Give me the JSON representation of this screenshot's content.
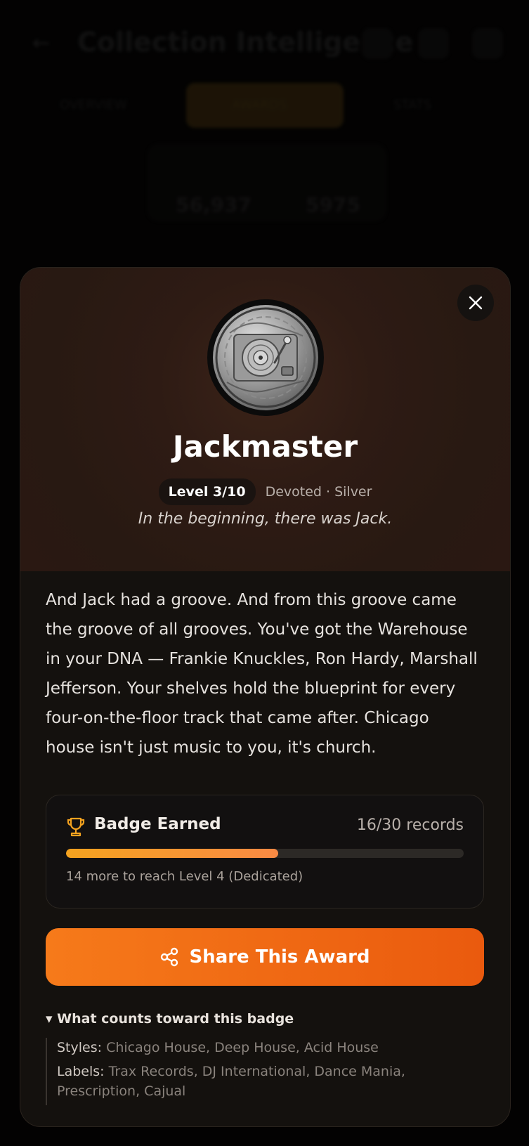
{
  "app": {
    "title": "Collection Intelligence"
  },
  "background": {
    "tabs": [
      "OVERVIEW",
      "AWARDS",
      "STATS"
    ],
    "stats": [
      "56,937",
      "5975"
    ]
  },
  "modal": {
    "badge_name": "Jackmaster",
    "level_label": "Level 3/10",
    "tier_label": "Devoted · Silver",
    "tagline": "In the beginning, there was Jack.",
    "description": "And Jack had a groove. And from this groove came the groove of all grooves. You've got the Warehouse in your DNA — Frankie Knuckles, Ron Hardy, Marshall Jefferson. Your shelves hold the blueprint for every four-on-the-floor track that came after. Chicago house isn't just music to you, it's church.",
    "progress": {
      "title": "Badge Earned",
      "count_label": "16/30 records",
      "current": 16,
      "target": 30,
      "fraction": 0.533,
      "next_label": "14 more to reach Level 4 (Dedicated)"
    },
    "share_label": "Share This Award",
    "criteria": {
      "toggle_label": "▾ What counts toward this badge",
      "styles_key": "Styles:",
      "styles_value": "Chicago House, Deep House, Acid House",
      "labels_key": "Labels:",
      "labels_value": "Trax Records, DJ International, Dance Mania, Prescription, Cajual"
    }
  },
  "colors": {
    "accent": "#f67a1a",
    "progress_start": "#f4a21f",
    "progress_end": "#f98a44",
    "hero_bg": "#2e1b14",
    "modal_bg": "#14110e"
  },
  "icons": {
    "close": "close-icon",
    "trophy": "trophy-icon",
    "share": "share-icon"
  }
}
